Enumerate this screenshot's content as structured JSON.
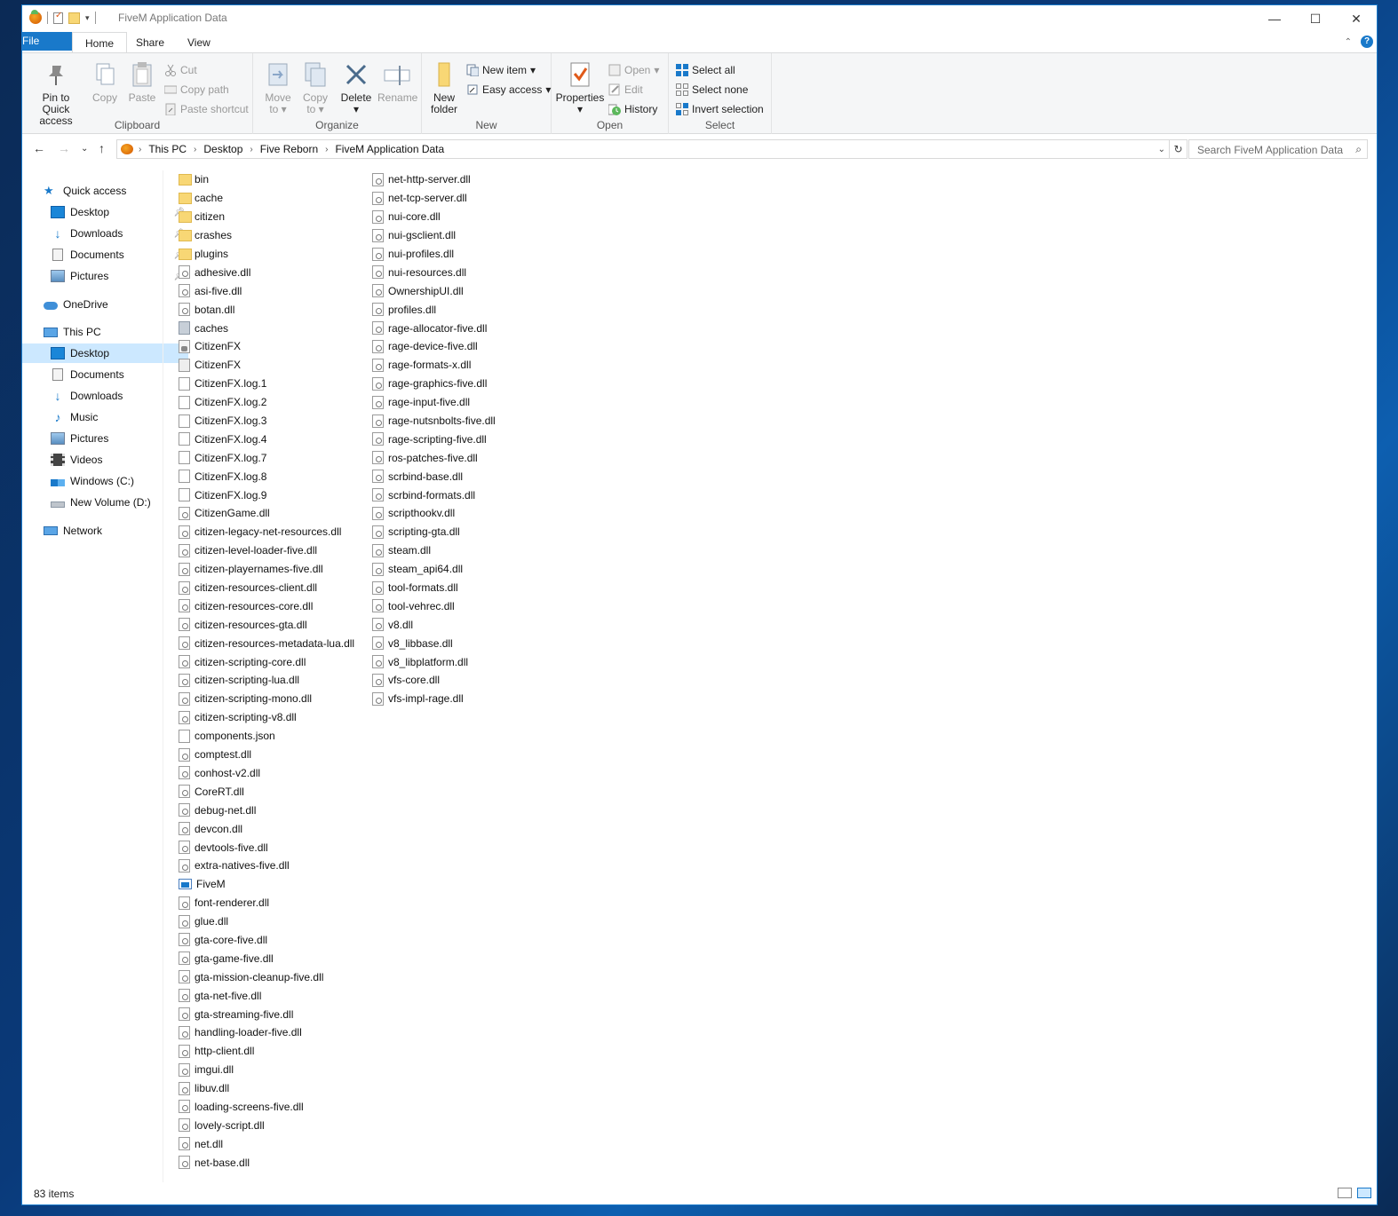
{
  "window": {
    "title": "FiveM Application Data",
    "controls": {
      "minimize": "—",
      "maximize": "☐",
      "close": "✕"
    }
  },
  "tabs": {
    "file": "File",
    "home": "Home",
    "share": "Share",
    "view": "View"
  },
  "ribbon": {
    "clipboard": {
      "label": "Clipboard",
      "pin_line1": "Pin to Quick",
      "pin_line2": "access",
      "copy": "Copy",
      "paste": "Paste",
      "cut": "Cut",
      "copy_path": "Copy path",
      "paste_shortcut": "Paste shortcut"
    },
    "organize": {
      "label": "Organize",
      "move_line1": "Move",
      "move_line2": "to",
      "copy_line1": "Copy",
      "copy_line2": "to",
      "delete": "Delete",
      "rename": "Rename"
    },
    "new": {
      "label": "New",
      "new_folder_line1": "New",
      "new_folder_line2": "folder",
      "new_item": "New item",
      "easy_access": "Easy access"
    },
    "open": {
      "label": "Open",
      "properties": "Properties",
      "open": "Open",
      "edit": "Edit",
      "history": "History"
    },
    "select": {
      "label": "Select",
      "select_all": "Select all",
      "select_none": "Select none",
      "invert": "Invert selection"
    }
  },
  "address": {
    "crumbs": [
      "This PC",
      "Desktop",
      "Five Reborn",
      "FiveM Application Data"
    ]
  },
  "search": {
    "placeholder": "Search FiveM Application Data"
  },
  "nav": {
    "quick_access": "Quick access",
    "qa_desktop": "Desktop",
    "qa_downloads": "Downloads",
    "qa_documents": "Documents",
    "qa_pictures": "Pictures",
    "onedrive": "OneDrive",
    "this_pc": "This PC",
    "pc_desktop": "Desktop",
    "pc_documents": "Documents",
    "pc_downloads": "Downloads",
    "pc_music": "Music",
    "pc_pictures": "Pictures",
    "pc_videos": "Videos",
    "pc_windows": "Windows (C:)",
    "pc_newvol": "New Volume (D:)",
    "network": "Network"
  },
  "files_col1": [
    {
      "name": "bin",
      "type": "folder"
    },
    {
      "name": "cache",
      "type": "folder"
    },
    {
      "name": "citizen",
      "type": "folder"
    },
    {
      "name": "crashes",
      "type": "folder"
    },
    {
      "name": "plugins",
      "type": "folder"
    },
    {
      "name": "adhesive.dll",
      "type": "dll"
    },
    {
      "name": "asi-five.dll",
      "type": "dll"
    },
    {
      "name": "botan.dll",
      "type": "dll"
    },
    {
      "name": "caches",
      "type": "cache"
    },
    {
      "name": "CitizenFX",
      "type": "cfg"
    },
    {
      "name": "CitizenFX",
      "type": "cfg2"
    },
    {
      "name": "CitizenFX.log.1",
      "type": "blank"
    },
    {
      "name": "CitizenFX.log.2",
      "type": "blank"
    },
    {
      "name": "CitizenFX.log.3",
      "type": "blank"
    },
    {
      "name": "CitizenFX.log.4",
      "type": "blank"
    },
    {
      "name": "CitizenFX.log.7",
      "type": "blank"
    },
    {
      "name": "CitizenFX.log.8",
      "type": "blank"
    },
    {
      "name": "CitizenFX.log.9",
      "type": "blank"
    },
    {
      "name": "CitizenGame.dll",
      "type": "dll"
    },
    {
      "name": "citizen-legacy-net-resources.dll",
      "type": "dll"
    },
    {
      "name": "citizen-level-loader-five.dll",
      "type": "dll"
    },
    {
      "name": "citizen-playernames-five.dll",
      "type": "dll"
    },
    {
      "name": "citizen-resources-client.dll",
      "type": "dll"
    },
    {
      "name": "citizen-resources-core.dll",
      "type": "dll"
    },
    {
      "name": "citizen-resources-gta.dll",
      "type": "dll"
    },
    {
      "name": "citizen-resources-metadata-lua.dll",
      "type": "dll"
    },
    {
      "name": "citizen-scripting-core.dll",
      "type": "dll"
    },
    {
      "name": "citizen-scripting-lua.dll",
      "type": "dll"
    },
    {
      "name": "citizen-scripting-mono.dll",
      "type": "dll"
    },
    {
      "name": "citizen-scripting-v8.dll",
      "type": "dll"
    },
    {
      "name": "components.json",
      "type": "blank"
    },
    {
      "name": "comptest.dll",
      "type": "dll"
    },
    {
      "name": "conhost-v2.dll",
      "type": "dll"
    },
    {
      "name": "CoreRT.dll",
      "type": "dll"
    },
    {
      "name": "debug-net.dll",
      "type": "dll"
    },
    {
      "name": "devcon.dll",
      "type": "dll"
    },
    {
      "name": "devtools-five.dll",
      "type": "dll"
    },
    {
      "name": "extra-natives-five.dll",
      "type": "dll"
    },
    {
      "name": "FiveM",
      "type": "exe"
    },
    {
      "name": "font-renderer.dll",
      "type": "dll"
    },
    {
      "name": "glue.dll",
      "type": "dll"
    },
    {
      "name": "gta-core-five.dll",
      "type": "dll"
    },
    {
      "name": "gta-game-five.dll",
      "type": "dll"
    },
    {
      "name": "gta-mission-cleanup-five.dll",
      "type": "dll"
    },
    {
      "name": "gta-net-five.dll",
      "type": "dll"
    },
    {
      "name": "gta-streaming-five.dll",
      "type": "dll"
    },
    {
      "name": "handling-loader-five.dll",
      "type": "dll"
    },
    {
      "name": "http-client.dll",
      "type": "dll"
    },
    {
      "name": "imgui.dll",
      "type": "dll"
    },
    {
      "name": "libuv.dll",
      "type": "dll"
    },
    {
      "name": "loading-screens-five.dll",
      "type": "dll"
    },
    {
      "name": "lovely-script.dll",
      "type": "dll"
    },
    {
      "name": "net.dll",
      "type": "dll"
    },
    {
      "name": "net-base.dll",
      "type": "dll"
    }
  ],
  "files_col2": [
    {
      "name": "net-http-server.dll",
      "type": "dll"
    },
    {
      "name": "net-tcp-server.dll",
      "type": "dll"
    },
    {
      "name": "nui-core.dll",
      "type": "dll"
    },
    {
      "name": "nui-gsclient.dll",
      "type": "dll"
    },
    {
      "name": "nui-profiles.dll",
      "type": "dll"
    },
    {
      "name": "nui-resources.dll",
      "type": "dll"
    },
    {
      "name": "OwnershipUI.dll",
      "type": "dll"
    },
    {
      "name": "profiles.dll",
      "type": "dll"
    },
    {
      "name": "rage-allocator-five.dll",
      "type": "dll"
    },
    {
      "name": "rage-device-five.dll",
      "type": "dll"
    },
    {
      "name": "rage-formats-x.dll",
      "type": "dll"
    },
    {
      "name": "rage-graphics-five.dll",
      "type": "dll"
    },
    {
      "name": "rage-input-five.dll",
      "type": "dll"
    },
    {
      "name": "rage-nutsnbolts-five.dll",
      "type": "dll"
    },
    {
      "name": "rage-scripting-five.dll",
      "type": "dll"
    },
    {
      "name": "ros-patches-five.dll",
      "type": "dll"
    },
    {
      "name": "scrbind-base.dll",
      "type": "dll"
    },
    {
      "name": "scrbind-formats.dll",
      "type": "dll"
    },
    {
      "name": "scripthookv.dll",
      "type": "dll"
    },
    {
      "name": "scripting-gta.dll",
      "type": "dll"
    },
    {
      "name": "steam.dll",
      "type": "dll"
    },
    {
      "name": "steam_api64.dll",
      "type": "dll"
    },
    {
      "name": "tool-formats.dll",
      "type": "dll"
    },
    {
      "name": "tool-vehrec.dll",
      "type": "dll"
    },
    {
      "name": "v8.dll",
      "type": "dll"
    },
    {
      "name": "v8_libbase.dll",
      "type": "dll"
    },
    {
      "name": "v8_libplatform.dll",
      "type": "dll"
    },
    {
      "name": "vfs-core.dll",
      "type": "dll"
    },
    {
      "name": "vfs-impl-rage.dll",
      "type": "dll"
    }
  ],
  "status": {
    "count": "83 items"
  },
  "colors": {
    "accent": "#1979ca",
    "selection": "#cce8ff",
    "folder": "#f8d775"
  }
}
